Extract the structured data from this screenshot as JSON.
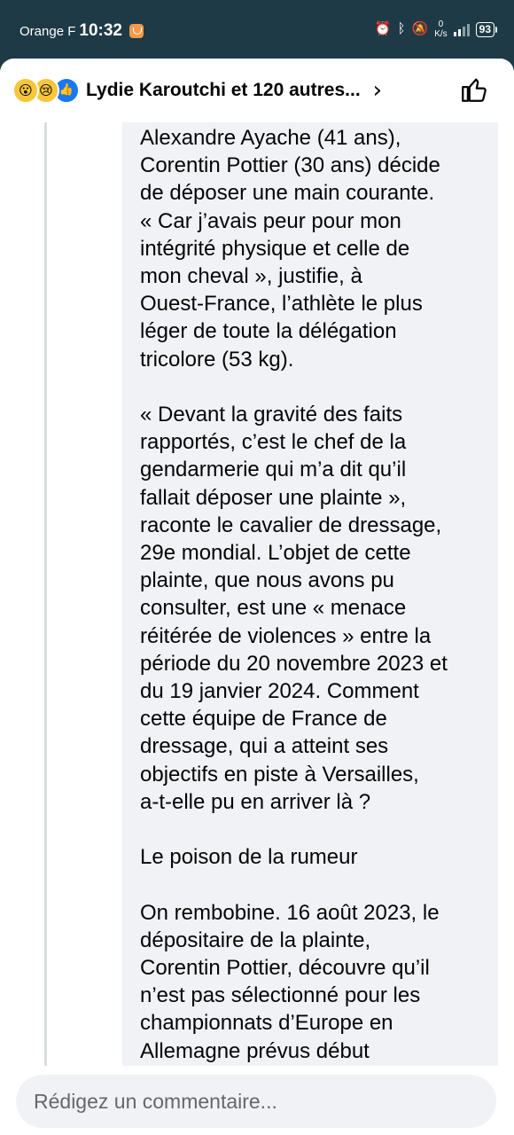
{
  "status_bar": {
    "carrier": "Orange F",
    "time": "10:32",
    "net_speed_value": "0",
    "net_speed_unit": "K/s",
    "battery": "93",
    "icons": [
      "alarm-icon",
      "bluetooth-icon",
      "mute-icon",
      "signal-icon",
      "battery-icon"
    ]
  },
  "header": {
    "reactions": [
      "wow-reaction",
      "sad-reaction",
      "like-reaction"
    ],
    "title": "Lydie Karoutchi et 120 autres...",
    "chevron": "›"
  },
  "comment": {
    "paragraphs": [
      [
        "Alexandre Ayache (41 ans),",
        "Corentin Pottier (30 ans) décide",
        "de déposer une main courante.",
        "« Car j’avais peur pour mon",
        "intégrité physique et celle de",
        "mon cheval », justifie, à",
        "Ouest-France, l’athlète le plus",
        "léger de toute la délégation",
        "tricolore (53 kg)."
      ],
      [
        "« Devant la gravité des faits",
        "rapportés, c’est le chef de la",
        "gendarmerie qui m’a dit qu’il",
        "fallait déposer une plainte »,",
        "raconte le cavalier de dressage,",
        "29e mondial. L’objet de cette",
        "plainte, que nous avons pu",
        "consulter, est une « menace",
        "réitérée de violences » entre la",
        "période du 20 novembre 2023 et",
        "du 19 janvier 2024. Comment",
        "cette équipe de France de",
        "dressage, qui a atteint ses",
        "objectifs en piste à Versailles,",
        "a-t-elle pu en arriver là ?"
      ],
      [
        "Le poison de la rumeur"
      ],
      [
        "On rembobine. 16 août 2023, le",
        "dépositaire de la plainte,",
        "Corentin Pottier, découvre qu’il",
        "n’est pas sélectionné pour les",
        "championnats d’Europe en",
        "Allemagne prévus début"
      ]
    ]
  },
  "composer": {
    "placeholder": "Rédigez un commentaire..."
  },
  "colors": {
    "status_bar_bg": "#1e3a46",
    "bubble_bg": "#f0f2f5",
    "like_blue": "#1877f2",
    "text": "#050505"
  }
}
